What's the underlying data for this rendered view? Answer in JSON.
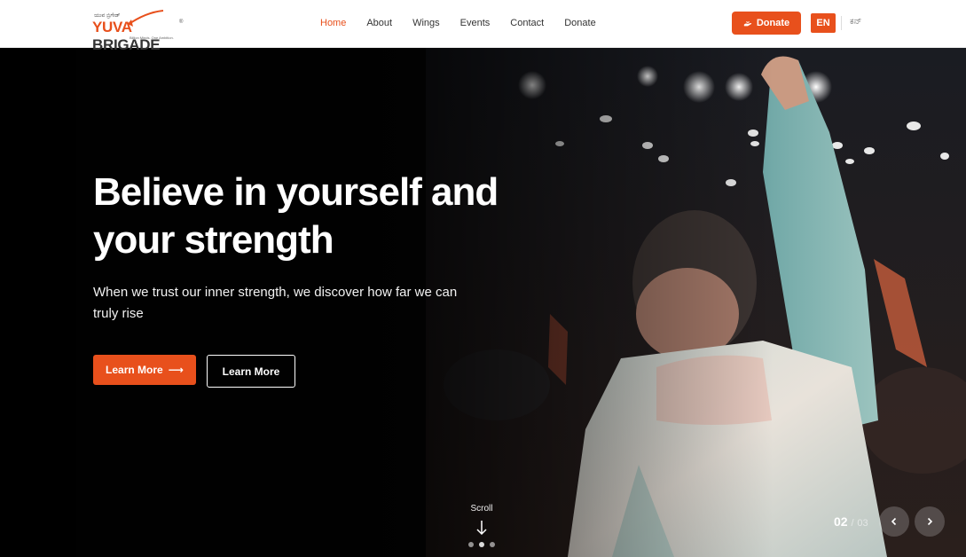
{
  "brand": {
    "kannada_text": "ಯುವ ಬ್ರಿಗೇಡ್",
    "name_v": "YUVA",
    "name_rest": " BRIGADE",
    "registered": "®",
    "tagline": "Billion Minds. One Ambition."
  },
  "nav": {
    "items": [
      {
        "label": "Home",
        "active": true
      },
      {
        "label": "About"
      },
      {
        "label": "Wings"
      },
      {
        "label": "Events"
      },
      {
        "label": "Contact"
      },
      {
        "label": "Donate"
      }
    ]
  },
  "header_actions": {
    "donate_label": "Donate",
    "lang_en": "EN",
    "lang_kn": "ಕನ್"
  },
  "hero": {
    "headline": "Believe in yourself and your strength",
    "subtext": "When we trust our inner strength, we discover how far we can truly rise",
    "primary_cta": "Learn More",
    "primary_cta_arrow": "⟶",
    "secondary_cta": "Learn More",
    "scroll_label": "Scroll",
    "slide_current": "02",
    "slide_separator": "/",
    "slide_total": "03",
    "dots_count": 3
  },
  "colors": {
    "accent": "#e8501c",
    "hero_bg": "#050505",
    "white": "#ffffff"
  },
  "icons": {
    "donate": "heart-hand-icon",
    "scroll": "arrow-down-icon",
    "prev": "chevron-left-icon",
    "next": "chevron-right-icon"
  }
}
